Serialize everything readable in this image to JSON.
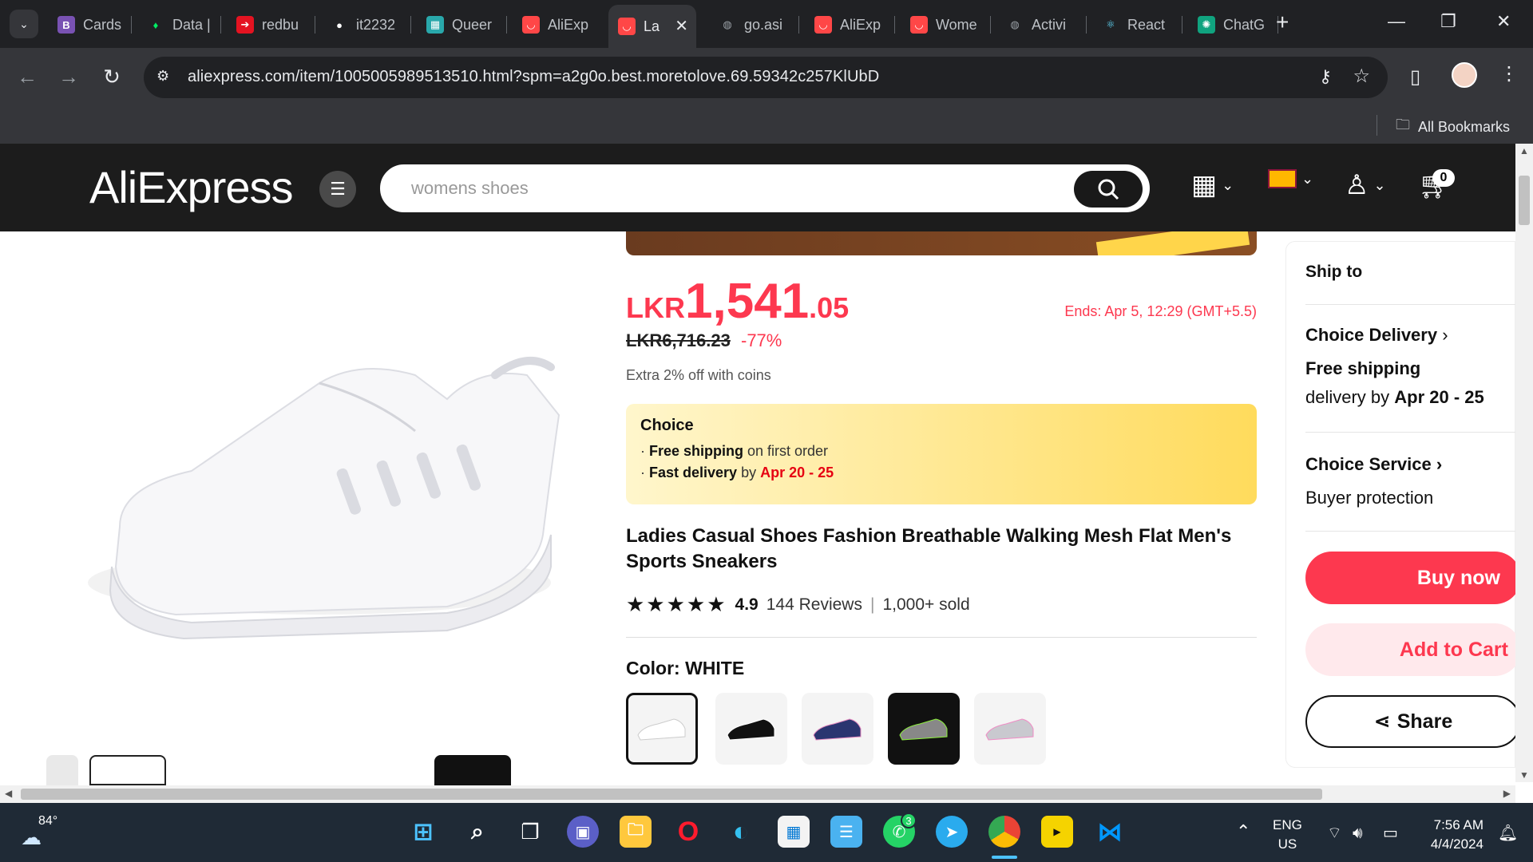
{
  "browser": {
    "tabs": [
      {
        "label": "Cards",
        "icon": "bootstrap-icon",
        "color": "#7952b3",
        "glyph": "B"
      },
      {
        "label": "Data |",
        "icon": "mongodb-leaf-icon",
        "color": "#00ed64",
        "glyph": "♦"
      },
      {
        "label": "redbu",
        "icon": "redbubble-icon",
        "color": "#e41321",
        "glyph": "➔"
      },
      {
        "label": "it2232",
        "icon": "github-icon",
        "color": "#ffffff",
        "glyph": "●"
      },
      {
        "label": "Queer",
        "icon": "queer-site-icon",
        "color": "#29a8ab",
        "glyph": "▦"
      },
      {
        "label": "AliExp",
        "icon": "aliexpress-icon",
        "color": "#ff4747",
        "glyph": "◡"
      },
      {
        "label": "La",
        "icon": "aliexpress-icon",
        "color": "#ff4747",
        "glyph": "◡",
        "active": true
      },
      {
        "label": "go.asi",
        "icon": "globe-icon",
        "color": "#9aa0a6",
        "glyph": "◍"
      },
      {
        "label": "AliExp",
        "icon": "aliexpress-icon",
        "color": "#ff4747",
        "glyph": "◡"
      },
      {
        "label": "Wome",
        "icon": "aliexpress-icon",
        "color": "#ff4747",
        "glyph": "◡"
      },
      {
        "label": "Activi",
        "icon": "globe-icon",
        "color": "#9aa0a6",
        "glyph": "◍"
      },
      {
        "label": "React",
        "icon": "react-icon",
        "color": "#61dafb",
        "glyph": "⚛"
      },
      {
        "label": "ChatG",
        "icon": "chatgpt-icon",
        "color": "#10a37f",
        "glyph": "✺"
      }
    ],
    "url": "aliexpress.com/item/1005005989513510.html?spm=a2g0o.best.moretolove.69.59342c257KlUbD",
    "all_bookmarks": "All Bookmarks"
  },
  "site": {
    "logo": "AliExpress",
    "search_value": "womens shoes",
    "cart_count": "0"
  },
  "product": {
    "price_currency": "LKR",
    "price_int": "1,541",
    "price_dec": ".05",
    "ends": "Ends: Apr 5, 12:29 (GMT+5.5)",
    "original_price": "LKR6,716.23",
    "discount": "-77%",
    "coins": "Extra 2% off with coins",
    "choice": {
      "title": "Choice",
      "line1_bold": "Free shipping",
      "line1_rest": " on first order",
      "line2_bold": "Fast delivery",
      "line2_mid": " by ",
      "line2_red": "Apr 20 - 25"
    },
    "title": "Ladies Casual Shoes Fashion Breathable Walking Mesh Flat Men's Sports Sneakers",
    "stars": "★★★★★",
    "rating": "4.9",
    "reviews": "144 Reviews",
    "sold": "1,000+ sold",
    "color_label": "Color: WHITE",
    "swatches": [
      "white",
      "black",
      "navy",
      "grey-green",
      "grey-pink"
    ]
  },
  "side": {
    "ship_to": "Ship to",
    "choice_delivery_bold": "Choice",
    "choice_delivery_rest": " Delivery",
    "free_shipping": "Free shipping",
    "delivery_by": "delivery by ",
    "delivery_date": "Apr 20 - 25",
    "choice_service": "Choice Service",
    "buyer_protection": "Buyer protection",
    "buy_now": "Buy now",
    "add_to_cart": "Add to Cart",
    "share": "Share"
  },
  "taskbar": {
    "weather": "84°",
    "lang1": "ENG",
    "lang2": "US",
    "time": "7:56 AM",
    "date": "4/4/2024",
    "whatsapp_badge": "3"
  }
}
